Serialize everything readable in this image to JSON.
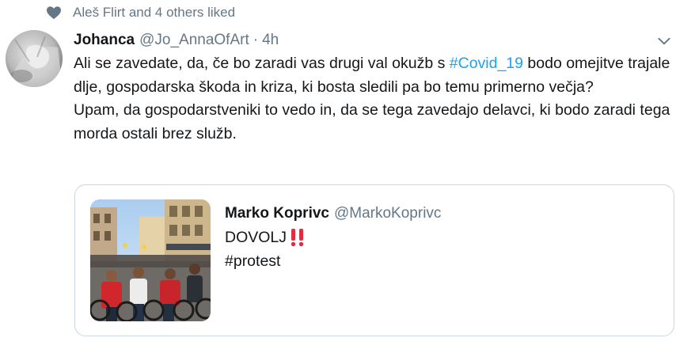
{
  "social_context": {
    "text": "Aleš Flirt and 4 others liked",
    "icon": "heart-icon"
  },
  "tweet": {
    "display_name": "Johanca",
    "handle": "@Jo_AnnaOfArt",
    "separator": "·",
    "time": "4h",
    "text_p1_before": "Ali se zavedate, da, če bo zaradi vas drugi val okužb s ",
    "hashtag": "#Covid_19",
    "text_p1_after": " bodo omejitve trajale dlje, gospodarska škoda in kriza, ki bosta sledili pa bo temu primerno večja?",
    "text_p2": "Upam, da gospodarstveniki to vedo in, da se tega zavedajo delavci, ki bodo zaradi tega morda ostali brez služb."
  },
  "quoted_tweet": {
    "display_name": "Marko Koprivc",
    "handle": "@MarkoKoprivc",
    "line1": "DOVOLJ",
    "line1_icon": "double-exclamation-icon",
    "line2": "#protest",
    "image": "protest-cyclists-photo"
  },
  "colors": {
    "accent": "#1da1f2",
    "muted": "#657786",
    "text": "#14171a",
    "border": "#ccd6dd",
    "exclaim": "#dd2e44"
  }
}
